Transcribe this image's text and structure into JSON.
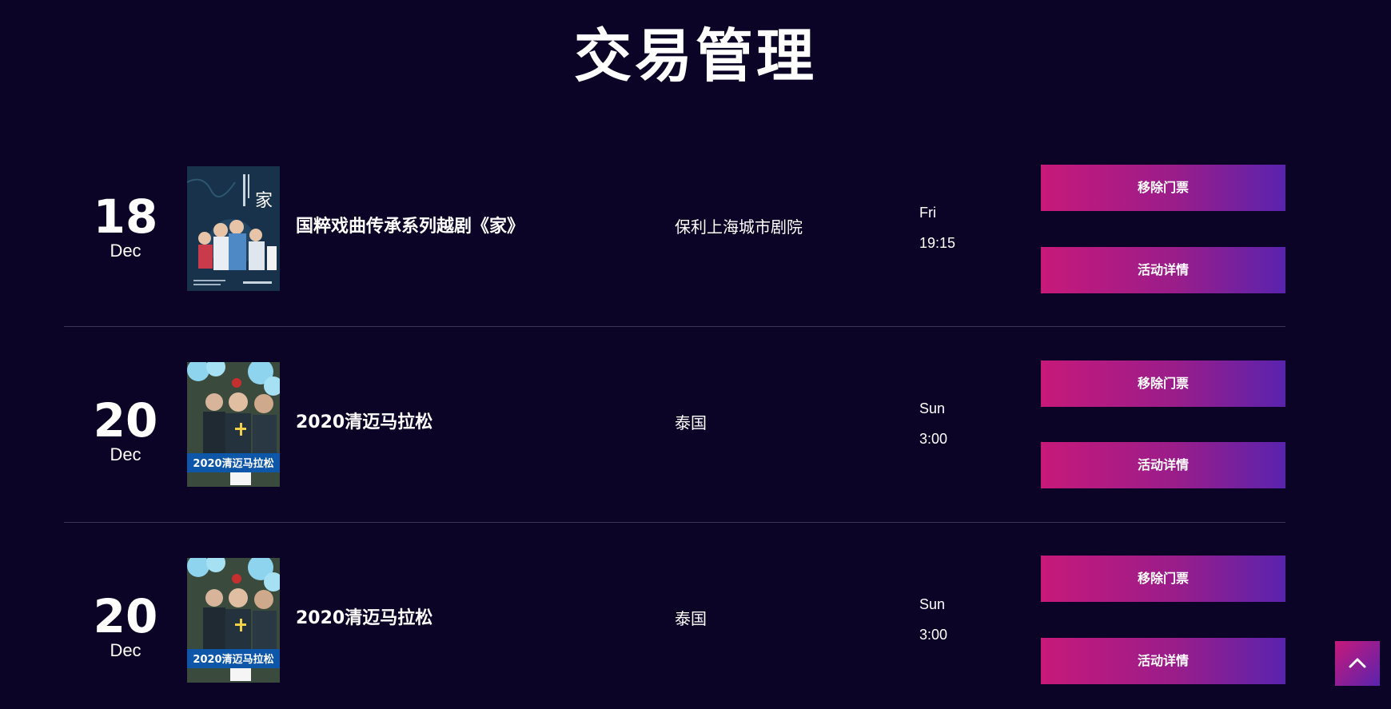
{
  "page": {
    "title": "交易管理"
  },
  "colors": {
    "background": "#0b0426",
    "button_gradient_start": "#c7197a",
    "button_gradient_end": "#5a23ae",
    "divider": "#3b3454"
  },
  "events": [
    {
      "day": "18",
      "month": "Dec",
      "name": "国粹戏曲传承系列越剧《家》",
      "venue": "保利上海城市剧院",
      "weekday": "Fri",
      "time": "19:15",
      "poster_icon": "opera-poster-image",
      "remove_label": "移除门票",
      "details_label": "活动详情"
    },
    {
      "day": "20",
      "month": "Dec",
      "name": "2020清迈马拉松",
      "venue": "泰国",
      "weekday": "Sun",
      "time": "3:00",
      "poster_icon": "marathon-poster-image",
      "poster_caption": "2020清迈马拉松",
      "remove_label": "移除门票",
      "details_label": "活动详情"
    },
    {
      "day": "20",
      "month": "Dec",
      "name": "2020清迈马拉松",
      "venue": "泰国",
      "weekday": "Sun",
      "time": "3:00",
      "poster_icon": "marathon-poster-image",
      "poster_caption": "2020清迈马拉松",
      "remove_label": "移除门票",
      "details_label": "活动详情"
    }
  ],
  "back_to_top": {
    "icon": "chevron-up-icon"
  }
}
